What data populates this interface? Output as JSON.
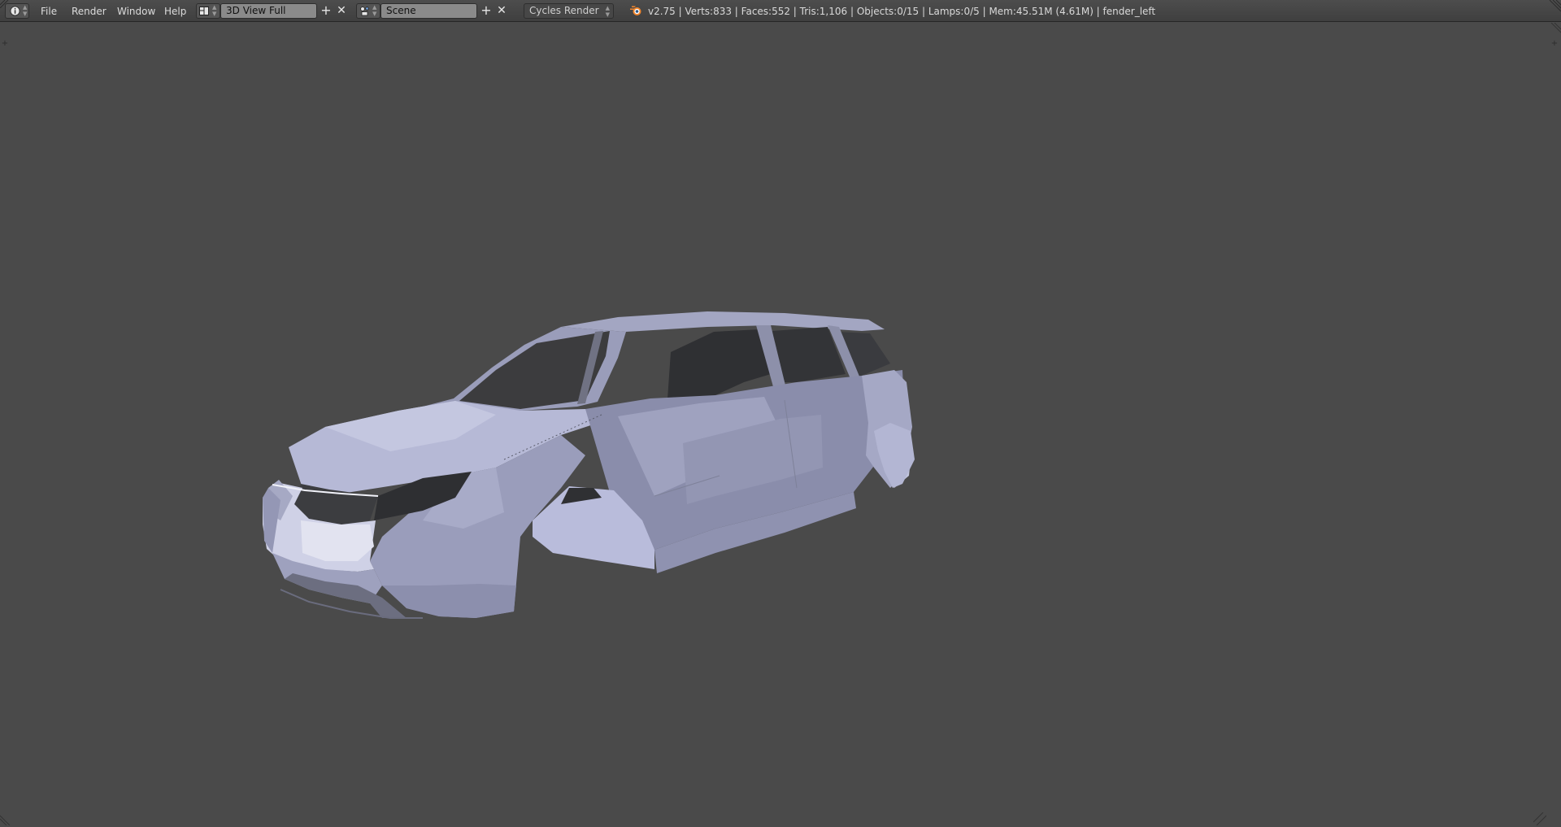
{
  "header": {
    "editor_type_icon": "info-icon",
    "menus": [
      "File",
      "Render",
      "Window",
      "Help"
    ],
    "screen_layout": {
      "icon": "screen-layout-icon",
      "value": "3D View Full",
      "add_icon": "plus-icon",
      "remove_icon": "x-icon"
    },
    "scene": {
      "icon": "scene-icon",
      "value": "Scene",
      "add_icon": "plus-icon",
      "remove_icon": "x-icon"
    },
    "render_engine": "Cycles Render",
    "blender_logo_icon": "blender-logo-icon",
    "stats": "v2.75 | Verts:833 | Faces:552 | Tris:1,106 | Objects:0/15 | Lamps:0/5 | Mem:45.51M (4.61M) | fender_left"
  },
  "viewport": {
    "background_color": "#4a4a4a",
    "object_color": "#b4b8d6",
    "object_description_icon": "car-body-mesh"
  },
  "colors": {
    "header_bg": "#444444",
    "field_bg": "#8a8a8a",
    "text": "#d9d9d9"
  }
}
